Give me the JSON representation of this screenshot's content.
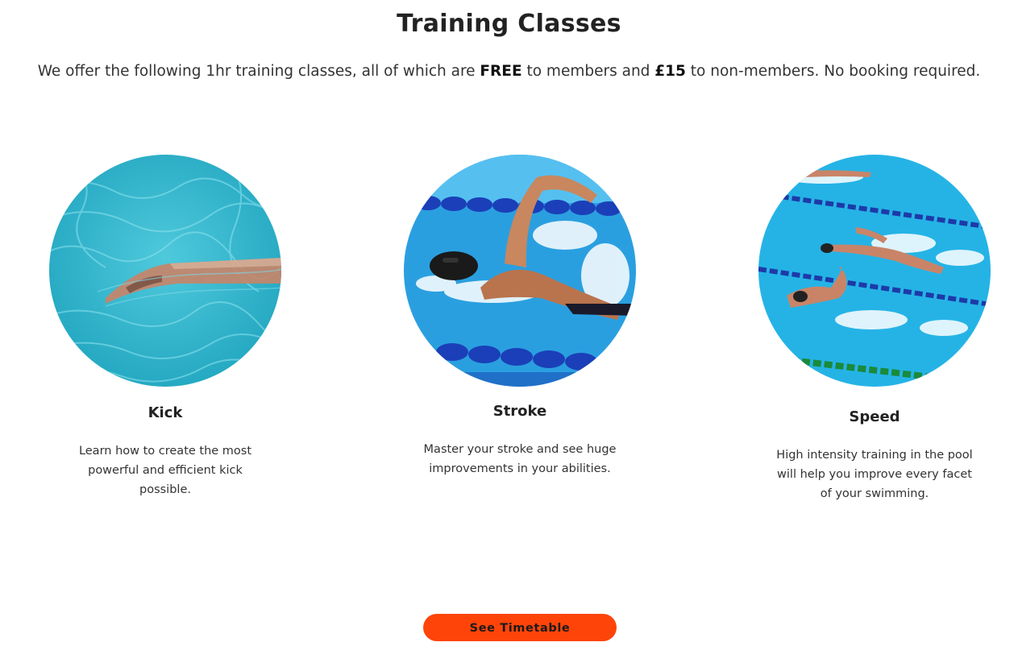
{
  "header": {
    "title": "Training Classes",
    "intro_before": "We offer the following 1hr training classes, all of which are ",
    "intro_free": "FREE",
    "intro_middle": " to members and ",
    "intro_price": "£15",
    "intro_after": " to non-members. No booking required."
  },
  "classes": [
    {
      "title": "Kick",
      "description": "Learn how to create the most powerful and efficient kick possible.",
      "image": "swimmer-kicking-photo"
    },
    {
      "title": "Stroke",
      "description": "Master your stroke and see huge improvements in your abilities.",
      "image": "swimmer-freestyle-stroke-photo"
    },
    {
      "title": "Speed",
      "description": "High intensity training in the pool will help you improve every facet of your swimming.",
      "image": "swimmers-racing-lanes-photo"
    }
  ],
  "cta": {
    "label": "See Timetable"
  },
  "colors": {
    "accent": "#ff4409",
    "pool_water": "#29b6d8",
    "lane_rope": "#1b3fb8",
    "text": "#222222"
  }
}
